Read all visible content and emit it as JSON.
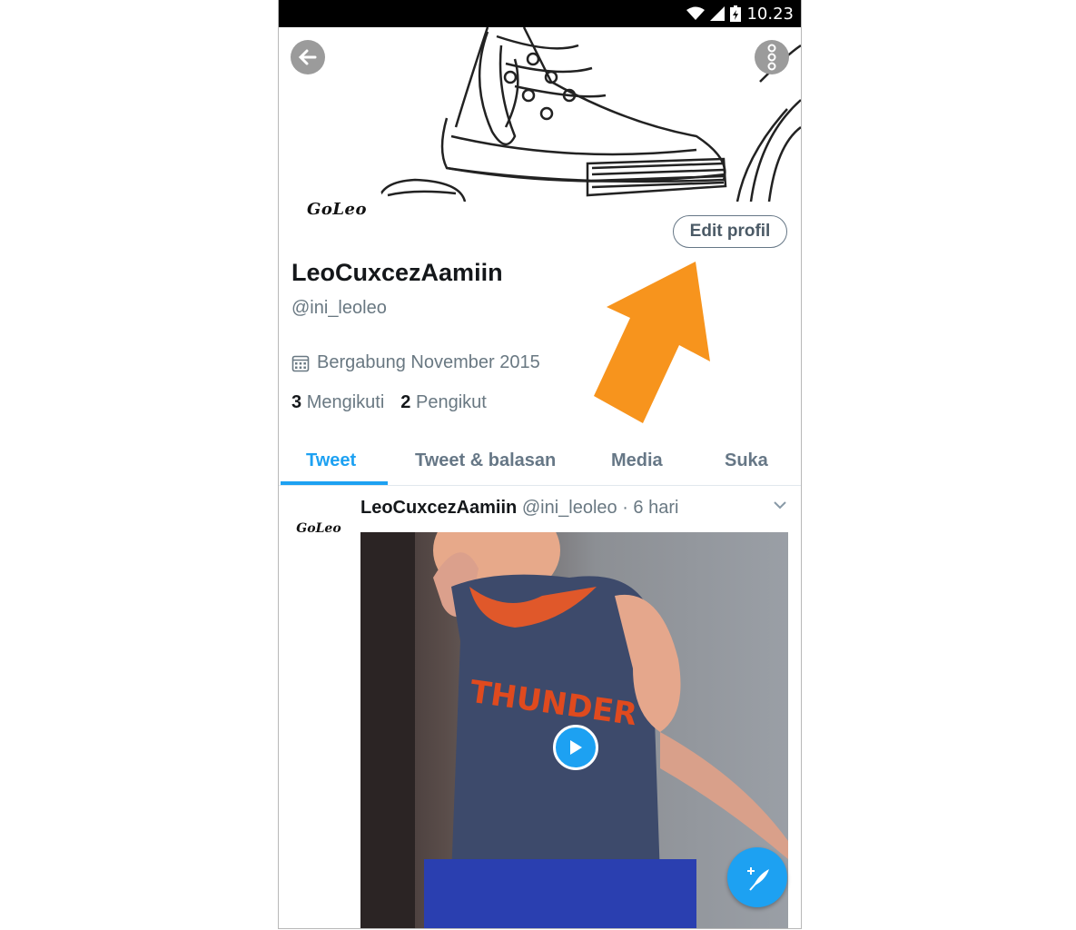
{
  "status_bar": {
    "time": "10.23"
  },
  "header": {
    "avatar_text": "GoLeo"
  },
  "profile": {
    "edit_button": "Edit profil",
    "name": "LeoCuxcezAamiin",
    "handle": "@ini_leoleo",
    "joined": "Bergabung November 2015",
    "following_count": "3",
    "following_label": "Mengikuti",
    "followers_count": "2",
    "followers_label": "Pengikut"
  },
  "tabs": [
    {
      "label": "Tweet",
      "active": true
    },
    {
      "label": "Tweet & balasan"
    },
    {
      "label": "Media"
    },
    {
      "label": "Suka"
    }
  ],
  "tweet": {
    "avatar_text": "GoLeo",
    "name": "LeoCuxcezAamiin",
    "handle": "@ini_leoleo",
    "time": "· 6 hari",
    "shirt_text": "THUNDER"
  },
  "colors": {
    "accent": "#1da1f2",
    "annotation_arrow": "#f7941d"
  }
}
